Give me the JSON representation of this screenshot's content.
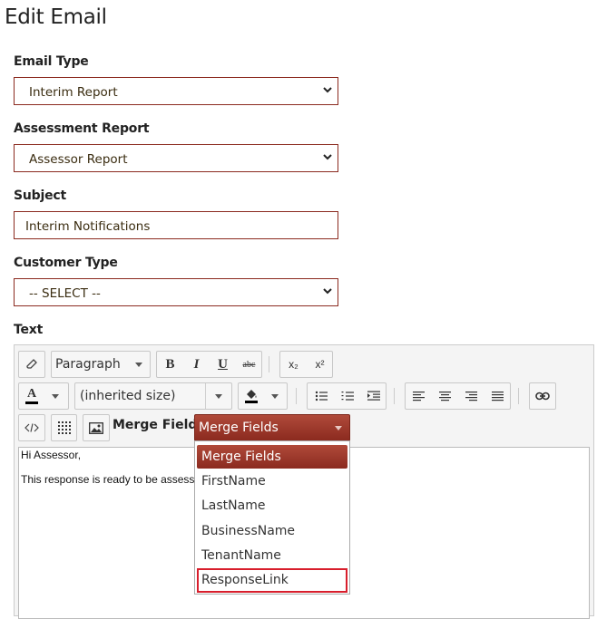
{
  "page": {
    "title": "Edit Email"
  },
  "form": {
    "email_type": {
      "label": "Email Type",
      "value": "Interim Report"
    },
    "assessment_report": {
      "label": "Assessment Report",
      "value": "Assessor Report"
    },
    "subject": {
      "label": "Subject",
      "value": "Interim Notifications"
    },
    "customer_type": {
      "label": "Customer Type",
      "value": "-- SELECT --"
    },
    "text": {
      "label": "Text"
    }
  },
  "editor": {
    "toolbar": {
      "format_value": "Paragraph",
      "bold": "B",
      "italic": "I",
      "underline": "U",
      "strike": "abc",
      "subscript": "x₂",
      "superscript": "x²",
      "font_color": "A",
      "size_value": "(inherited size)",
      "icons": [
        "eraser-icon",
        "source-code-icon",
        "table-icon",
        "image-icon",
        "link-icon",
        "paint-bucket-icon",
        "bullet-list-icon",
        "number-list-icon",
        "indent-icon",
        "align-left-icon",
        "align-center-icon",
        "align-right-icon",
        "align-justify-icon"
      ]
    },
    "merge_fields": {
      "label": "Merge Fields:",
      "value": "Merge Fields",
      "options": [
        "Merge Fields",
        "FirstName",
        "LastName",
        "BusinessName",
        "TenantName",
        "ResponseLink"
      ],
      "selected_index": 0,
      "highlighted_index": 5
    },
    "content": {
      "line1": "Hi Assessor,",
      "line2": "This response is ready to be assesse"
    }
  },
  "colors": {
    "accent": "#8b2a1f",
    "highlight": "#d81e2c"
  }
}
